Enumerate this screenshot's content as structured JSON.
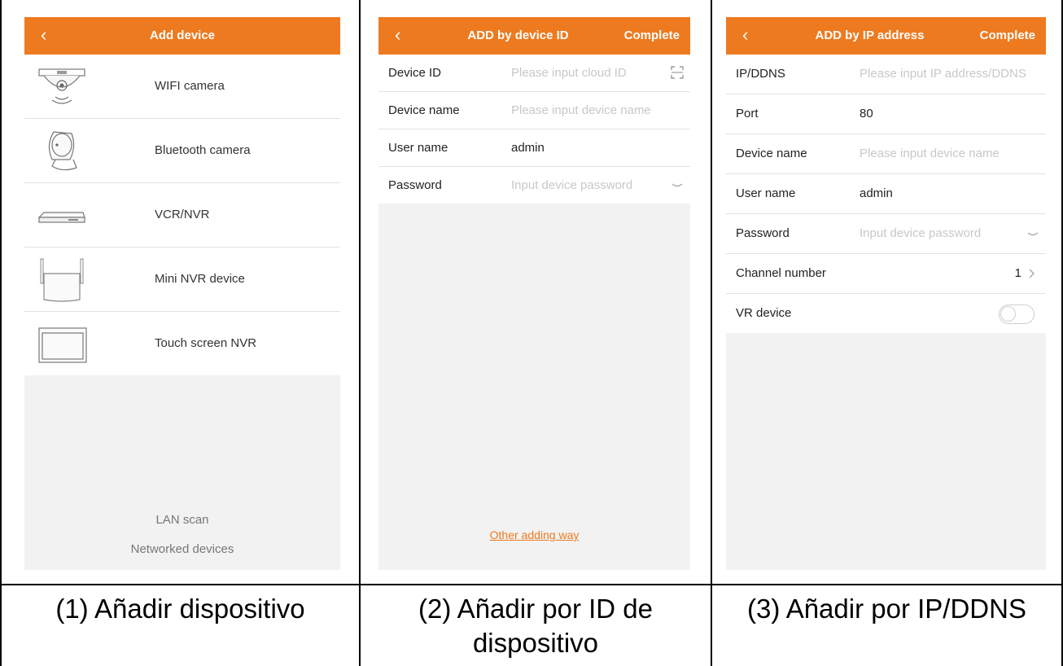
{
  "panel1": {
    "nav": {
      "back": "‹",
      "title": "Add device"
    },
    "devices": [
      {
        "label": "WIFI camera",
        "icon": "dome-camera-icon"
      },
      {
        "label": "Bluetooth camera",
        "icon": "cube-camera-icon"
      },
      {
        "label": "VCR/NVR",
        "icon": "nvr-box-icon"
      },
      {
        "label": "Mini NVR device",
        "icon": "mini-nvr-antenna-icon"
      },
      {
        "label": "Touch screen NVR",
        "icon": "touch-screen-nvr-icon"
      }
    ],
    "lan_scan": "LAN scan",
    "networked_devices": "Networked devices"
  },
  "panel2": {
    "nav": {
      "back": "‹",
      "title": "ADD by device ID",
      "action": "Complete"
    },
    "fields": [
      {
        "label": "Device ID",
        "placeholder": "Please input cloud ID",
        "icon": "scan-qr-icon"
      },
      {
        "label": "Device name",
        "placeholder": "Please input device name"
      },
      {
        "label": "User name",
        "value": "admin"
      },
      {
        "label": "Password",
        "placeholder": "Input device password",
        "icon": "eye-closed-icon"
      }
    ],
    "other_way": "Other adding way"
  },
  "panel3": {
    "nav": {
      "back": "‹",
      "title": "ADD by IP address",
      "action": "Complete"
    },
    "fields": [
      {
        "label": "IP/DDNS",
        "placeholder": "Please input IP address/DDNS"
      },
      {
        "label": "Port",
        "value": "80"
      },
      {
        "label": "Device name",
        "placeholder": "Please input device name"
      },
      {
        "label": "User name",
        "value": "admin"
      },
      {
        "label": "Password",
        "placeholder": "Input device password",
        "icon": "eye-closed-icon"
      },
      {
        "label": "Channel number",
        "value": "1",
        "icon": "chevron-right-icon"
      },
      {
        "label": "VR device",
        "toggle": false
      }
    ]
  },
  "captions": {
    "c1": "(1) Añadir dispositivo",
    "c2_line1": "(2) Añadir por ID de",
    "c2_line2": "dispositivo",
    "c3": "(3) Añadir por IP/DDNS"
  },
  "colors": {
    "accent": "#ee7a1f",
    "background": "#f2f2f2"
  }
}
